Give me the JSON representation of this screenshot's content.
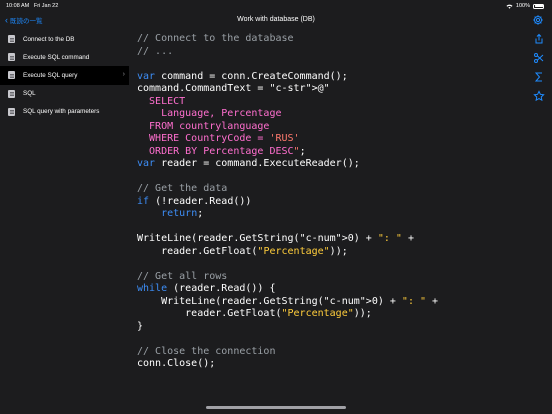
{
  "status": {
    "time": "10:08 AM",
    "date": "Fri Jan 22",
    "battery": "100%"
  },
  "nav": {
    "back_label": "既読の一覧",
    "title": "Work with database (DB)"
  },
  "sidebar": {
    "items": [
      {
        "label": "Connect to the DB",
        "icon": "document-icon",
        "selected": false
      },
      {
        "label": "Execute SQL command",
        "icon": "document-icon",
        "selected": false
      },
      {
        "label": "Execute SQL query",
        "icon": "document-icon",
        "selected": true
      },
      {
        "label": "SQL",
        "icon": "document-icon",
        "selected": false
      },
      {
        "label": "SQL query with parameters",
        "icon": "document-icon",
        "selected": false
      }
    ]
  },
  "toolbar_icons": [
    "share-icon",
    "scissors-icon",
    "sigma-icon",
    "star-icon"
  ],
  "code": {
    "language": "csharp",
    "lines": [
      "// Connect to the database",
      "// ...",
      "",
      "var command = conn.CreateCommand();",
      "command.CommandText = @\"",
      "  SELECT",
      "    Language, Percentage",
      "  FROM countrylanguage",
      "  WHERE CountryCode = 'RUS'",
      "  ORDER BY Percentage DESC\";",
      "var reader = command.ExecuteReader();",
      "",
      "// Get the data",
      "if (!reader.Read())",
      "    return;",
      "",
      "WriteLine(reader.GetString(0) + \": \" +",
      "    reader.GetFloat(\"Percentage\"));",
      "",
      "// Get all rows",
      "while (reader.Read()) {",
      "    WriteLine(reader.GetString(0) + \": \" +",
      "        reader.GetFloat(\"Percentage\"));",
      "}",
      "",
      "// Close the connection",
      "conn.Close();"
    ]
  },
  "colors": {
    "accent": "#1e8bff",
    "background": "#1c1c1e",
    "selected_row": "#000000",
    "comment": "#9aa0a6",
    "keyword": "#3d8df5",
    "string": "#ff7a6e",
    "sql": "#ff6fcf",
    "number": "#c9b66a"
  }
}
